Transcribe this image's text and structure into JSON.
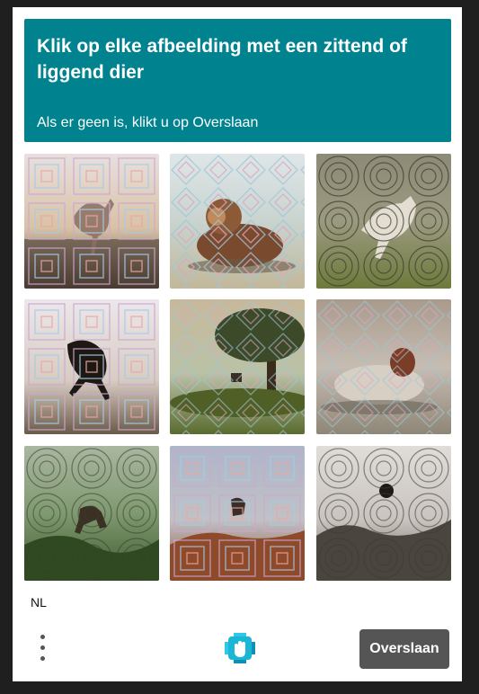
{
  "challenge": {
    "prompt": "Klik op elke afbeelding met een zittend of liggend dier",
    "hint": "Als er geen is, klikt u op Overslaan"
  },
  "grid": {
    "tiles": [
      {
        "pattern": "squares",
        "subject": "leaping goat"
      },
      {
        "pattern": "diamonds",
        "subject": "lying ram"
      },
      {
        "pattern": "circles",
        "subject": "goat on grass"
      },
      {
        "pattern": "squares",
        "subject": "jumping dark animal"
      },
      {
        "pattern": "diamonds",
        "subject": "small animal under tree"
      },
      {
        "pattern": "diamonds",
        "subject": "lying sheep"
      },
      {
        "pattern": "circles",
        "subject": "animal in forest"
      },
      {
        "pattern": "squares",
        "subject": "small animal on rocks"
      },
      {
        "pattern": "circles",
        "subject": "bird on rocks"
      }
    ]
  },
  "footer": {
    "language": "NL",
    "menu_icon": "kebab-menu-icon",
    "logo_icon": "hcaptcha-hand-logo",
    "skip_label": "Overslaan"
  },
  "colors": {
    "header_bg": "#00838f",
    "skip_bg": "#555555",
    "page_bg": "#1f1f1f"
  }
}
